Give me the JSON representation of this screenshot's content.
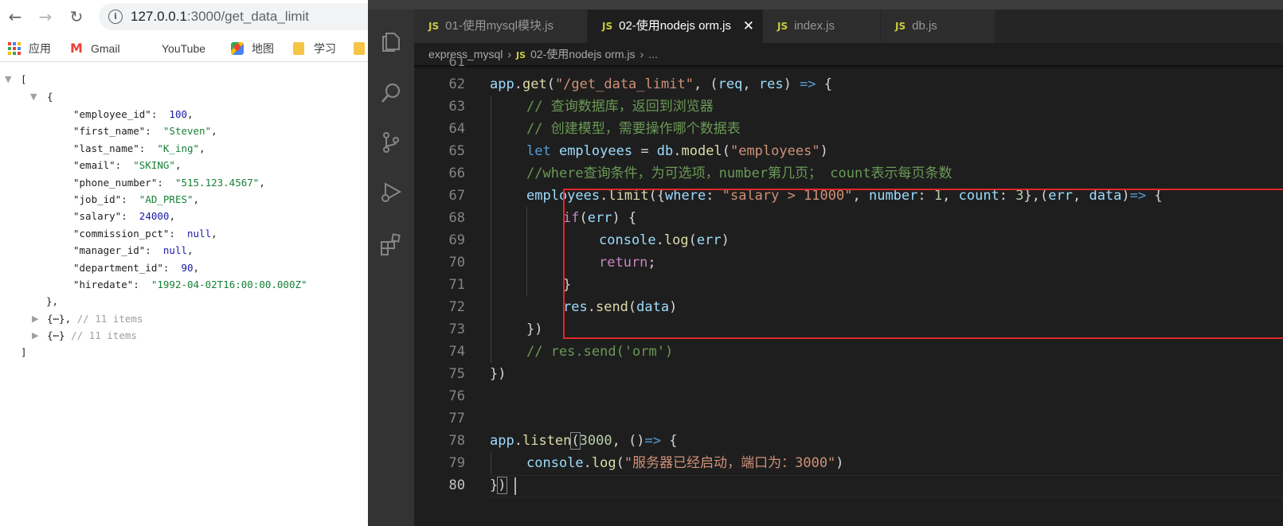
{
  "browser": {
    "url_host": "127.0.0.1",
    "url_path": ":3000/get_data_limit",
    "bookmarks": [
      {
        "label": "应用"
      },
      {
        "label": "Gmail"
      },
      {
        "label": "YouTube"
      },
      {
        "label": "地图"
      },
      {
        "label": "学习"
      }
    ],
    "json_lines": {
      "open_array": "[",
      "open_obj": "{",
      "fields": [
        {
          "key": "\"employee_id\":",
          "value": "100",
          "type": "num"
        },
        {
          "key": "\"first_name\":",
          "value": "\"Steven\"",
          "type": "str"
        },
        {
          "key": "\"last_name\":",
          "value": "\"K_ing\"",
          "type": "str"
        },
        {
          "key": "\"email\":",
          "value": "\"SKING\"",
          "type": "str"
        },
        {
          "key": "\"phone_number\":",
          "value": "\"515.123.4567\"",
          "type": "str"
        },
        {
          "key": "\"job_id\":",
          "value": "\"AD_PRES\"",
          "type": "str"
        },
        {
          "key": "\"salary\":",
          "value": "24000",
          "type": "num"
        },
        {
          "key": "\"commission_pct\":",
          "value": "null",
          "type": "null"
        },
        {
          "key": "\"manager_id\":",
          "value": "null",
          "type": "null"
        },
        {
          "key": "\"department_id\":",
          "value": "90",
          "type": "num"
        },
        {
          "key": "\"hiredate\":",
          "value": "\"1992-04-02T16:00:00.000Z\"",
          "type": "str"
        }
      ],
      "close_obj": "},",
      "collapsed_1": "{⋯},",
      "collapsed_1_comment": "// 11 items",
      "collapsed_2": "{⋯}",
      "collapsed_2_comment": "// 11 items",
      "close_array": "]"
    }
  },
  "editor": {
    "tabs": [
      {
        "label": "01-使用mysql模块.js",
        "badge": "JS"
      },
      {
        "label": "02-使用nodejs orm.js",
        "badge": "JS",
        "active": true
      },
      {
        "label": "index.js",
        "badge": "JS"
      },
      {
        "label": "db.js",
        "badge": "JS"
      }
    ],
    "breadcrumb": {
      "folder": "express_mysql",
      "badge": "JS",
      "file": "02-使用nodejs orm.js",
      "more": "..."
    },
    "line_numbers": [
      "62",
      "63",
      "64",
      "65",
      "66",
      "67",
      "68",
      "69",
      "70",
      "71",
      "72",
      "73",
      "74",
      "75",
      "76",
      "77",
      "78",
      "79",
      "80"
    ],
    "partial_line_number": "61",
    "code": {
      "l62": {
        "a": "app",
        "b": ".",
        "c": "get",
        "d": "(",
        "e": "\"/get_data_limit\"",
        "f": ", (",
        "g": "req",
        "h": ", ",
        "i": "res",
        "j": ") ",
        "k": "=>",
        "l": " {"
      },
      "l63": "// 查询数据库，返回到浏览器",
      "l64": "// 创建模型，需要操作哪个数据表",
      "l65": {
        "a": "let",
        "b": " employees",
        "c": " = ",
        "d": "db",
        "e": ".",
        "f": "model",
        "g": "(",
        "h": "\"employees\"",
        "i": ")"
      },
      "l66": "//where查询条件，为可选项，number第几页； count表示每页条数",
      "l67": {
        "a": "employees",
        "b": ".",
        "c": "limit",
        "d": "({",
        "e": "where",
        "f": ": ",
        "g": "\"salary > 11000\"",
        "h": ", ",
        "i": "number",
        "j": ": ",
        "k": "1",
        "l": ", ",
        "m": "count",
        "n": ": ",
        "o": "3",
        "p": "},(",
        "q": "err",
        "r": ", ",
        "s": "data",
        "t": ")",
        "u": "=>",
        "v": " {"
      },
      "l68": {
        "a": "if",
        "b": "(",
        "c": "err",
        "d": ") {"
      },
      "l69": {
        "a": "console",
        "b": ".",
        "c": "log",
        "d": "(",
        "e": "err",
        "f": ")"
      },
      "l70": {
        "a": "return",
        "b": ";"
      },
      "l71": "}",
      "l72": {
        "a": "res",
        "b": ".",
        "c": "send",
        "d": "(",
        "e": "data",
        "f": ")"
      },
      "l73": "})",
      "l74": "// res.send('orm')",
      "l75": "})",
      "l78": {
        "a": "app",
        "b": ".",
        "c": "listen",
        "d": "(",
        "e": "3000",
        "f": ", ()",
        "g": "=>",
        "h": " {"
      },
      "l79": {
        "a": "console",
        "b": ".",
        "c": "log",
        "d": "(",
        "e": "\"服务器已经启动，端口为：3000\"",
        "f": ")"
      },
      "l80": {
        "a": "}",
        "b": ")"
      }
    }
  },
  "colors": {
    "editor_bg": "#1e1e1e",
    "highlight_box": "#e3262b",
    "keyword": "#569cd6",
    "string": "#ce9178",
    "comment": "#6a9955"
  }
}
